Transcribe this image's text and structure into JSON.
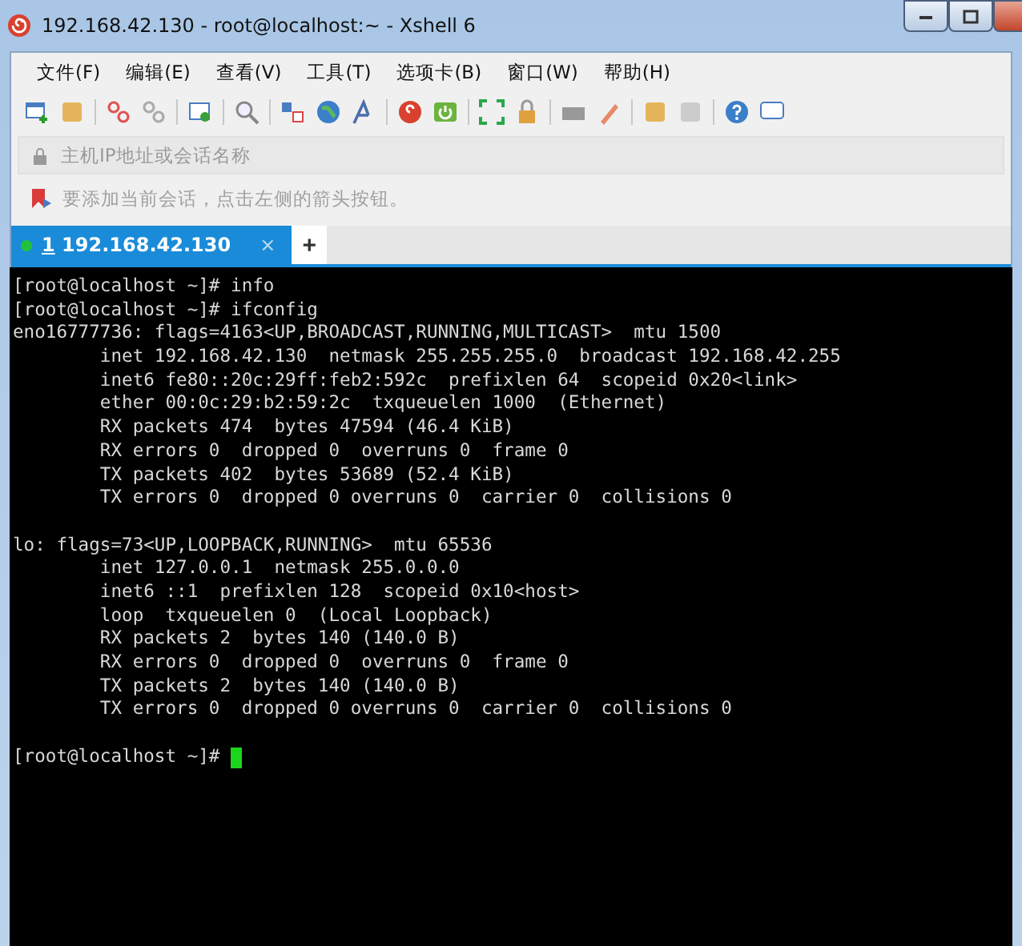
{
  "window": {
    "title": "192.168.42.130 - root@localhost:~ - Xshell 6"
  },
  "menu": [
    "文件(F)",
    "编辑(E)",
    "查看(V)",
    "工具(T)",
    "选项卡(B)",
    "窗口(W)",
    "帮助(H)"
  ],
  "address_bar": {
    "placeholder": "主机IP地址或会话名称"
  },
  "info_bar": {
    "text": "要添加当前会话，点击左侧的箭头按钮。"
  },
  "tabs": [
    {
      "number": "1",
      "label": "192.168.42.130",
      "selected": true,
      "connected": true,
      "close": "×"
    }
  ],
  "new_tab": "+",
  "terminal": {
    "blocks": [
      [
        "[root@localhost ~]# info",
        "[root@localhost ~]# ifconfig",
        "eno16777736: flags=4163<UP,BROADCAST,RUNNING,MULTICAST>  mtu 1500",
        "        inet 192.168.42.130  netmask 255.255.255.0  broadcast 192.168.42.255",
        "        inet6 fe80::20c:29ff:feb2:592c  prefixlen 64  scopeid 0x20<link>",
        "        ether 00:0c:29:b2:59:2c  txqueuelen 1000  (Ethernet)",
        "        RX packets 474  bytes 47594 (46.4 KiB)",
        "        RX errors 0  dropped 0  overruns 0  frame 0",
        "        TX packets 402  bytes 53689 (52.4 KiB)",
        "        TX errors 0  dropped 0 overruns 0  carrier 0  collisions 0"
      ],
      [
        "lo: flags=73<UP,LOOPBACK,RUNNING>  mtu 65536",
        "        inet 127.0.0.1  netmask 255.0.0.0",
        "        inet6 ::1  prefixlen 128  scopeid 0x10<host>",
        "        loop  txqueuelen 0  (Local Loopback)",
        "        RX packets 2  bytes 140 (140.0 B)",
        "        RX errors 0  dropped 0  overruns 0  frame 0",
        "        TX packets 2  bytes 140 (140.0 B)",
        "        TX errors 0  dropped 0 overruns 0  carrier 0  collisions 0"
      ],
      [
        "[root@localhost ~]#"
      ]
    ],
    "cursor": true
  }
}
